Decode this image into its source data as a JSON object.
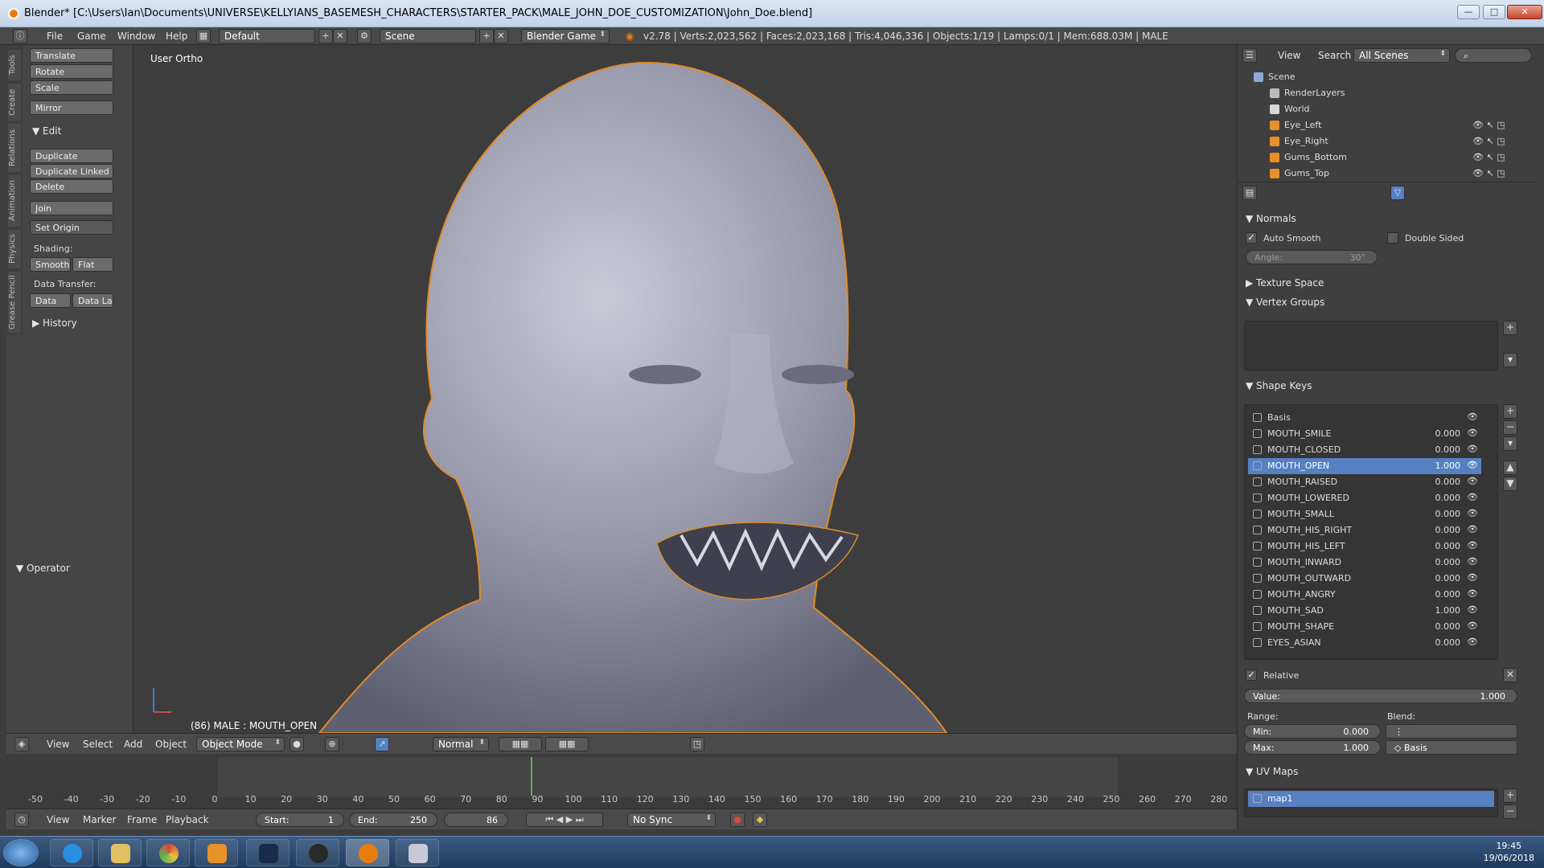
{
  "window": {
    "title": "Blender* [C:\\Users\\Ian\\Documents\\UNIVERSE\\KELLYIANS_BASEMESH_CHARACTERS\\STARTER_PACK\\MALE_JOHN_DOE_CUSTOMIZATION\\John_Doe.blend]",
    "btn_min": "—",
    "btn_max": "□",
    "btn_close": "✕"
  },
  "infobar": {
    "menus": [
      "File",
      "Game",
      "Window",
      "Help"
    ],
    "layout": "Default",
    "scene": "Scene",
    "engine": "Blender Game",
    "stats": "v2.78 | Verts:2,023,562 | Faces:2,023,168 | Tris:4,046,336 | Objects:1/19 | Lamps:0/1 | Mem:688.03M | MALE"
  },
  "toolshelf": {
    "tabs": [
      "Tools",
      "Create",
      "Relations",
      "Animation",
      "Physics",
      "Grease Pencil"
    ],
    "transform": [
      "Translate",
      "Rotate",
      "Scale"
    ],
    "mirror": "Mirror",
    "edit_header": "Edit",
    "edit_buttons": [
      "Duplicate",
      "Duplicate Linked",
      "Delete"
    ],
    "join": "Join",
    "set_origin": "Set Origin",
    "shading_label": "Shading:",
    "shading": [
      "Smooth",
      "Flat"
    ],
    "data_transfer_label": "Data Transfer:",
    "data_transfer": [
      "Data",
      "Data La"
    ],
    "history": "History",
    "operator": "Operator"
  },
  "viewport": {
    "view_label": "User Ortho",
    "status": "(86) MALE : MOUTH_OPEN"
  },
  "viewport_header": {
    "menus": [
      "View",
      "Select",
      "Add",
      "Object"
    ],
    "mode": "Object Mode",
    "orientation": "Normal"
  },
  "timeline": {
    "ticks": [
      "-50",
      "-40",
      "-30",
      "-20",
      "-10",
      "0",
      "10",
      "20",
      "30",
      "40",
      "50",
      "60",
      "70",
      "80",
      "90",
      "100",
      "110",
      "120",
      "130",
      "140",
      "150",
      "160",
      "170",
      "180",
      "190",
      "200",
      "210",
      "220",
      "230",
      "240",
      "250",
      "260",
      "270",
      "280"
    ],
    "menus": [
      "View",
      "Marker",
      "Frame",
      "Playback"
    ],
    "start_label": "Start:",
    "start": "1",
    "end_label": "End:",
    "end": "250",
    "current": "86",
    "sync": "No Sync"
  },
  "outliner": {
    "menus": [
      "View",
      "Search"
    ],
    "filter": "All Scenes",
    "items": [
      "Scene",
      "RenderLayers",
      "World",
      "Eye_Left",
      "Eye_Right",
      "Gums_Bottom",
      "Gums_Top"
    ]
  },
  "properties": {
    "normals": "Normals",
    "auto_smooth": "Auto Smooth",
    "double_sided": "Double Sided",
    "angle_label": "Angle:",
    "angle": "30°",
    "texture_space": "Texture Space",
    "vertex_groups": "Vertex Groups",
    "shape_keys": "Shape Keys",
    "keys": [
      {
        "name": "Basis",
        "value": ""
      },
      {
        "name": "MOUTH_SMILE",
        "value": "0.000"
      },
      {
        "name": "MOUTH_CLOSED",
        "value": "0.000"
      },
      {
        "name": "MOUTH_OPEN",
        "value": "1.000"
      },
      {
        "name": "MOUTH_RAISED",
        "value": "0.000"
      },
      {
        "name": "MOUTH_LOWERED",
        "value": "0.000"
      },
      {
        "name": "MOUTH_SMALL",
        "value": "0.000"
      },
      {
        "name": "MOUTH_HIS_RIGHT",
        "value": "0.000"
      },
      {
        "name": "MOUTH_HIS_LEFT",
        "value": "0.000"
      },
      {
        "name": "MOUTH_INWARD",
        "value": "0.000"
      },
      {
        "name": "MOUTH_OUTWARD",
        "value": "0.000"
      },
      {
        "name": "MOUTH_ANGRY",
        "value": "0.000"
      },
      {
        "name": "MOUTH_SAD",
        "value": "1.000"
      },
      {
        "name": "MOUTH_SHAPE",
        "value": "0.000"
      },
      {
        "name": "EYES_ASIAN",
        "value": "0.000"
      }
    ],
    "relative": "Relative",
    "value_label": "Value:",
    "value": "1.000",
    "range_label": "Range:",
    "blend_label": "Blend:",
    "min_label": "Min:",
    "min": "0.000",
    "max_label": "Max:",
    "max": "1.000",
    "blend_basis": "Basis",
    "uv_maps": "UV Maps",
    "uv_map": "map1"
  },
  "taskbar": {
    "time": "19:45",
    "date": "19/06/2018"
  }
}
